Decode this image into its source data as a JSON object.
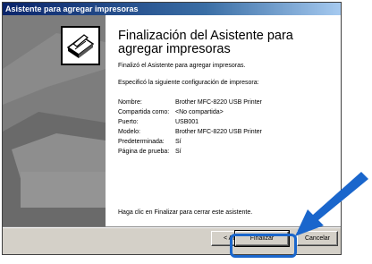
{
  "window": {
    "title": "Asistente para agregar impresoras"
  },
  "header": {
    "title": "Finalización del Asistente para agregar impresoras"
  },
  "body": {
    "intro": "Finalizó el Asistente para agregar impresoras.",
    "config_intro": "Especificó la siguiente configuración de impresora:",
    "settings": [
      {
        "label": "Nombre:",
        "value": "Brother MFC-8220 USB Printer"
      },
      {
        "label": "Compartida como:",
        "value": "<No compartida>"
      },
      {
        "label": "Puerto:",
        "value": "USB001"
      },
      {
        "label": "Modelo:",
        "value": "Brother MFC-8220 USB Printer"
      },
      {
        "label": "Predeterminada:",
        "value": "Sí"
      },
      {
        "label": "Página de prueba:",
        "value": "Sí"
      }
    ],
    "finish_note": "Haga clic en Finalizar para cerrar este asistente."
  },
  "buttons": {
    "back": "< Atrás",
    "finish": "Finalizar",
    "cancel": "Cancelar"
  },
  "icons": {
    "wizard": "printer-wizard-icon",
    "pointer": "arrow-pointer-icon"
  },
  "colors": {
    "title_bar": "#0a246a",
    "annotation": "#1a66cc",
    "dialog_face": "#d4d0c8"
  }
}
